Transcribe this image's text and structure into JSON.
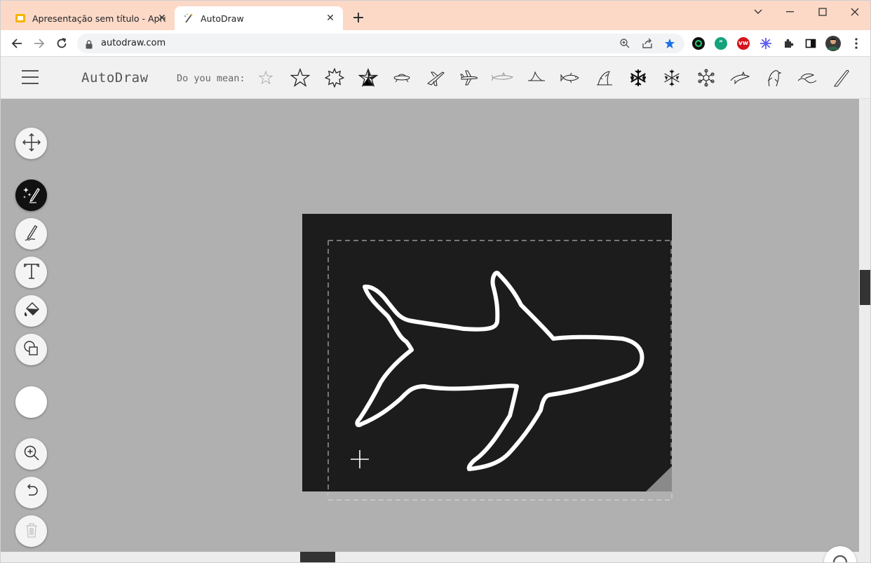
{
  "browser": {
    "tabs": [
      {
        "title": "Apresentação sem título - Apresentaç",
        "favicon": "slides-icon",
        "active": false
      },
      {
        "title": "AutoDraw",
        "favicon": "autodraw-icon",
        "active": true
      }
    ],
    "url": "autodraw.com",
    "extensions": [
      "grammarly-icon",
      "quote-extension-icon",
      "vw-extension-icon",
      "sparkle-extension-icon",
      "puzzle-icon",
      "sidepanel-icon",
      "profile-avatar"
    ]
  },
  "app": {
    "brand": "AutoDraw",
    "suggestion_prompt": "Do you mean:",
    "suggestions": [
      "star-thin",
      "star",
      "starburst",
      "nautical-star",
      "spaceship",
      "airplane-takeoff",
      "airplane",
      "shark-swimming",
      "shark-fin",
      "fish",
      "shark-jumping",
      "snowflake-dense",
      "snowflake",
      "snowflake-round",
      "dolphin",
      "bird",
      "wave-dolphins",
      "bat"
    ],
    "tools": [
      {
        "name": "select",
        "icon": "move-icon"
      },
      {
        "name": "autodraw",
        "icon": "autodraw-pen-icon",
        "active": true
      },
      {
        "name": "draw",
        "icon": "pencil-icon"
      },
      {
        "name": "type",
        "icon": "text-icon"
      },
      {
        "name": "fill",
        "icon": "fill-bucket-icon"
      },
      {
        "name": "shape",
        "icon": "shapes-icon"
      },
      {
        "name": "color",
        "icon": "color-swatch",
        "value": "#ffffff"
      },
      {
        "name": "zoom",
        "icon": "zoom-in-icon"
      },
      {
        "name": "undo",
        "icon": "undo-icon"
      },
      {
        "name": "delete",
        "icon": "trash-icon",
        "disabled": true
      }
    ],
    "canvas": {
      "background": "#1c1c1c",
      "stroke_color": "#ffffff"
    }
  }
}
